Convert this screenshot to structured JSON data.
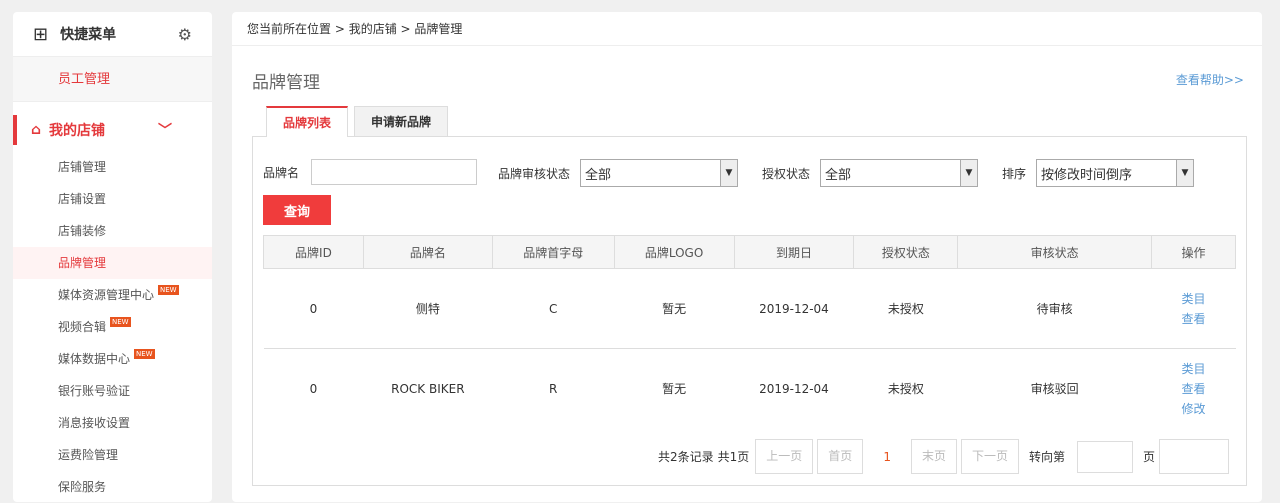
{
  "sidebar": {
    "quick_title": "快捷菜单",
    "quick_item": "员工管理",
    "section": "我的店铺",
    "items": [
      {
        "label": "店铺管理"
      },
      {
        "label": "店铺设置"
      },
      {
        "label": "店铺装修"
      },
      {
        "label": "品牌管理"
      },
      {
        "label": "媒体资源管理中心",
        "badge": "NEW"
      },
      {
        "label": "视频合辑",
        "badge": "NEW"
      },
      {
        "label": "媒体数据中心",
        "badge": "NEW"
      },
      {
        "label": "银行账号验证"
      },
      {
        "label": "消息接收设置"
      },
      {
        "label": "运费险管理"
      },
      {
        "label": "保险服务"
      }
    ]
  },
  "breadcrumb": [
    "您当前所在位置",
    "我的店铺",
    "品牌管理"
  ],
  "page_title": "品牌管理",
  "help": "查看帮助>>",
  "tabs": [
    "品牌列表",
    "申请新品牌"
  ],
  "filters": {
    "name_label": "品牌名",
    "name_value": "",
    "audit_label": "品牌审核状态",
    "audit_value": "全部",
    "auth_label": "授权状态",
    "auth_value": "全部",
    "sort_label": "排序",
    "sort_value": "按修改时间倒序",
    "search": "查询"
  },
  "table": {
    "headers": [
      "品牌ID",
      "品牌名",
      "品牌首字母",
      "品牌LOGO",
      "到期日",
      "授权状态",
      "审核状态",
      "操作"
    ],
    "rows": [
      {
        "cells": [
          "0",
          "侧特",
          "C",
          "暂无",
          "2019-12-04",
          "未授权",
          "待审核"
        ],
        "ops": [
          "类目",
          "查看"
        ]
      },
      {
        "cells": [
          "0",
          "ROCK BIKER",
          "R",
          "暂无",
          "2019-12-04",
          "未授权",
          "审核驳回"
        ],
        "ops": [
          "类目",
          "查看",
          "修改"
        ]
      }
    ]
  },
  "pager": {
    "records": "共2条记录",
    "pages": "共1页",
    "prev": "上一页",
    "first": "首页",
    "current": "1",
    "last": "末页",
    "next": "下一页",
    "goto": "转向第",
    "page_unit": "页"
  }
}
